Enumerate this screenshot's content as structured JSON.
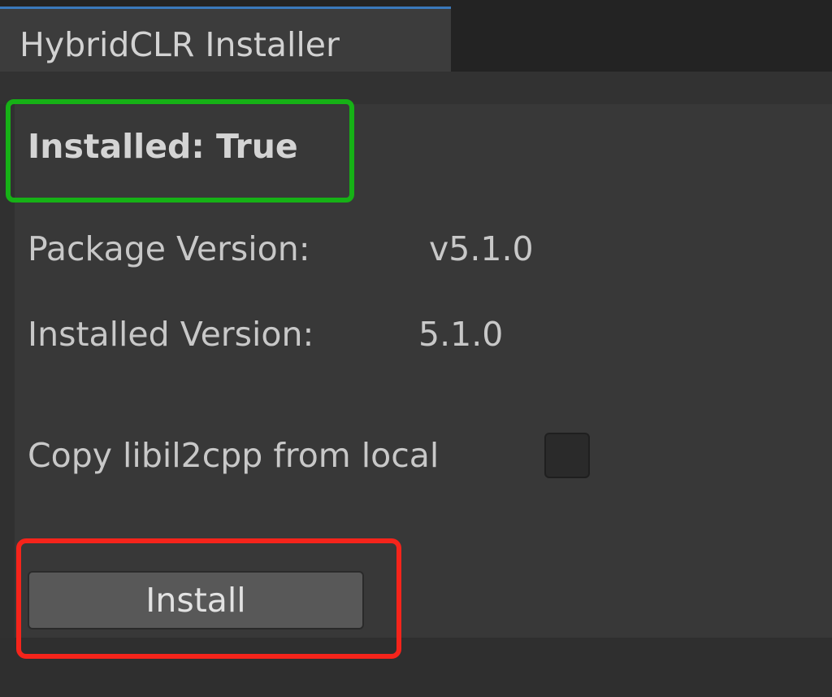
{
  "window": {
    "tab_title": "HybridCLR Installer"
  },
  "status": {
    "installed_label": "Installed: True"
  },
  "info": {
    "package_version_label": "Package Version:",
    "package_version_value": "v5.1.0",
    "installed_version_label": "Installed Version:",
    "installed_version_value": "5.1.0"
  },
  "options": {
    "copy_libil2cpp_label": "Copy libil2cpp from local",
    "copy_libil2cpp_checked": false
  },
  "actions": {
    "install_label": "Install"
  },
  "colors": {
    "highlight_status": "#16b116",
    "highlight_action": "#f5241b",
    "tab_accent": "#3a79bb"
  }
}
